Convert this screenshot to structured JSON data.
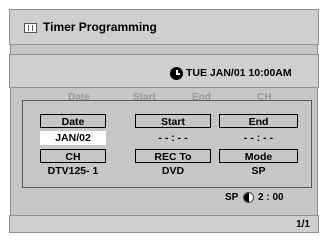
{
  "title": "Timer Programming",
  "datetime": "TUE JAN/01 10:00AM",
  "background_headers": [
    "Date",
    "Start",
    "End",
    "CH"
  ],
  "fields": {
    "date_label": "Date",
    "date_value": "JAN/02",
    "start_label": "Start",
    "start_value": "- - : - -",
    "end_label": "End",
    "end_value": "- - : - -",
    "ch_label": "CH",
    "ch_value": "DTV125- 1",
    "recto_label": "REC To",
    "recto_value": "DVD",
    "mode_label": "Mode",
    "mode_value": "SP"
  },
  "remaining": {
    "mode": "SP",
    "time": "2 : 00"
  },
  "page": "1/1",
  "icons": {
    "title": "timer-list-icon",
    "clock": "clock-icon",
    "disc": "disc-remaining-icon"
  },
  "colors": {
    "panel_bg": "#c6c6c6",
    "selected_bg": "#ffffff",
    "text": "#000000"
  }
}
